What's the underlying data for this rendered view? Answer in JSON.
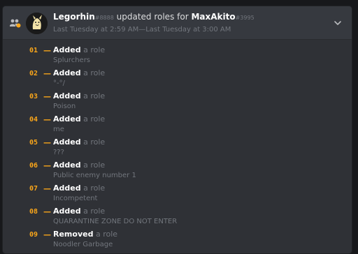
{
  "header": {
    "actor": "Legorhin",
    "actor_discriminator": "#8888",
    "action_text": " updated roles for ",
    "target": "MaxAkito",
    "target_discriminator": "#3995",
    "timestamps": "Last Tuesday at 2:59 AM—Last Tuesday at 3:00 AM"
  },
  "dash": "—",
  "changes": [
    {
      "num": "01",
      "action": "Added",
      "suffix": " a role",
      "role": "Splurchers"
    },
    {
      "num": "02",
      "action": "Added",
      "suffix": " a role",
      "role": "°-°/"
    },
    {
      "num": "03",
      "action": "Added",
      "suffix": " a role",
      "role": "Poison"
    },
    {
      "num": "04",
      "action": "Added",
      "suffix": " a role",
      "role": "me"
    },
    {
      "num": "05",
      "action": "Added",
      "suffix": " a role",
      "role": "???"
    },
    {
      "num": "06",
      "action": "Added",
      "suffix": " a role",
      "role": "Public enemy number 1"
    },
    {
      "num": "07",
      "action": "Added",
      "suffix": " a role",
      "role": "Incompetent"
    },
    {
      "num": "08",
      "action": "Added",
      "suffix": " a role",
      "role": "QUARANTINE ZONE DO NOT ENTER"
    },
    {
      "num": "09",
      "action": "Removed",
      "suffix": " a role",
      "role": "Noodler Garbage"
    }
  ],
  "colors": {
    "number": "#faa61a",
    "background": "#2f3136",
    "header_background": "#36393f"
  }
}
